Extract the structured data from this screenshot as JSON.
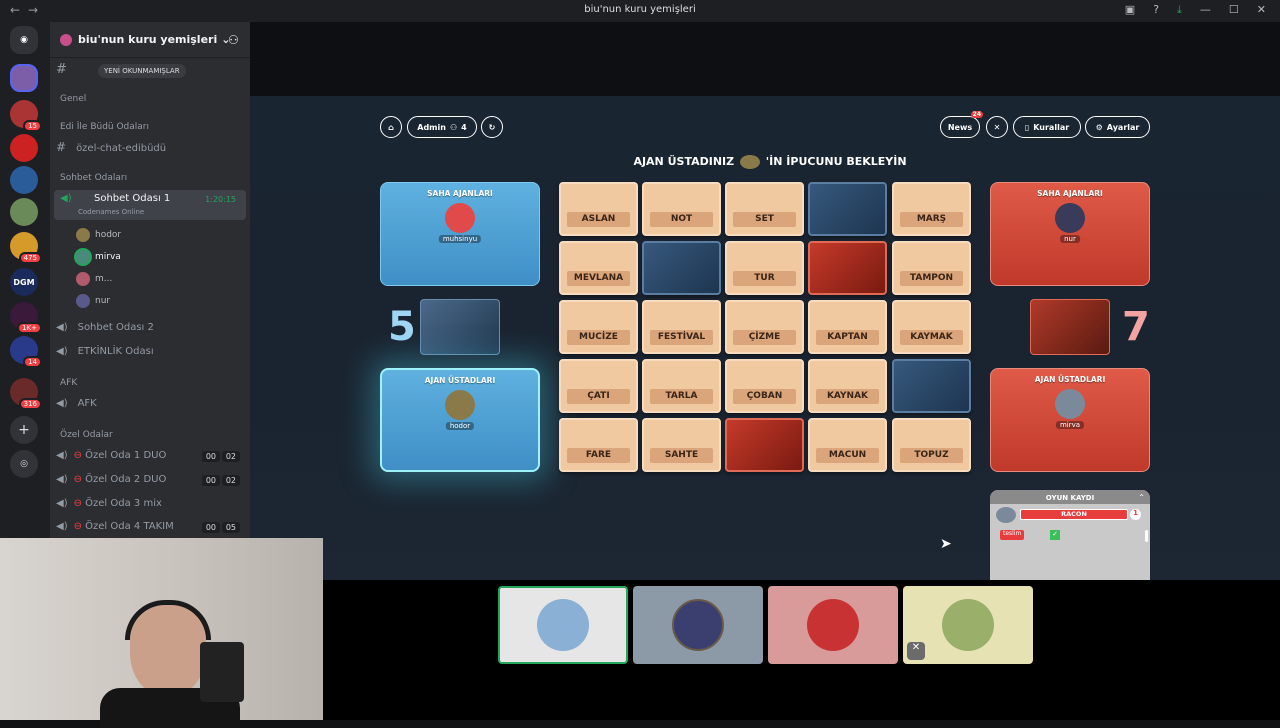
{
  "window": {
    "title": "biu'nun kuru yemişleri"
  },
  "sidebar": {
    "guild_name": "biu'nun kuru yemişleri",
    "unread_pill": "YENİ OKUNMAMIŞLAR",
    "server_badges": [
      "15",
      "475",
      "1K+",
      "14",
      "316"
    ],
    "server_label_dgm": "DGM",
    "categories": {
      "genel": "Genel",
      "edi_budu": "Edi İle Büdü Odaları",
      "sohbet": "Sohbet Odaları",
      "afk": "AFK",
      "ozel": "Özel Odalar"
    },
    "channels": {
      "ozel_chat": "özel-chat-edibüdü",
      "sohbet1": "Sohbet Odası 1",
      "sohbet1_activity": "Codenames Online",
      "sohbet1_time": "1:20:15",
      "sohbet2": "Sohbet Odası 2",
      "etkinlik": "ETKİNLİK Odası",
      "afk": "AFK",
      "oda1": "Özel Oda 1 DUO",
      "oda2": "Özel Oda 2 DUO",
      "oda3": "Özel Oda 3 mix",
      "oda4": "Özel Oda 4 TAKIM"
    },
    "voice_users": [
      "hodor",
      "mirva",
      "m...",
      "nur"
    ],
    "room_counts": {
      "oda1": [
        "00",
        "02"
      ],
      "oda2": [
        "00",
        "02"
      ],
      "oda4": [
        "00",
        "05"
      ]
    }
  },
  "game": {
    "buttons": {
      "admin": "Admin",
      "players": "4",
      "news": "News",
      "news_badge": "24",
      "rules": "Kurallar",
      "settings": "Ayarlar"
    },
    "banner_pre": "AJAN ÜSTADINIZ",
    "banner_post": "'İN İPUCUNU BEKLEYİN",
    "blue": {
      "operatives_label": "SAHA AJANLARI",
      "operative": "muhsinyu",
      "spymaster_label": "AJAN ÜSTADLARI",
      "spymaster": "hodor",
      "score": "5"
    },
    "red": {
      "operatives_label": "SAHA AJANLARI",
      "operative": "nur",
      "spymaster_label": "AJAN ÜSTADLARI",
      "spymaster": "mirva",
      "score": "7"
    },
    "cards": [
      [
        "ASLAN",
        "NOT",
        "SET",
        "",
        "MARŞ"
      ],
      [
        "MEVLANA",
        "",
        "TUR",
        "",
        "TAMPON"
      ],
      [
        "MUCİZE",
        "FESTİVAL",
        "ÇİZME",
        "KAPTAN",
        "KAYMAK"
      ],
      [
        "ÇATI",
        "TARLA",
        "ÇOBAN",
        "KAYNAK",
        ""
      ],
      [
        "FARE",
        "SAHTE",
        "",
        "MACUN",
        "TOPUZ"
      ]
    ],
    "card_colors": [
      [
        "n",
        "n",
        "n",
        "b",
        "n"
      ],
      [
        "n",
        "b",
        "n",
        "r",
        "n"
      ],
      [
        "n",
        "n",
        "n",
        "n",
        "n"
      ],
      [
        "n",
        "n",
        "n",
        "n",
        "b"
      ],
      [
        "n",
        "n",
        "r",
        "n",
        "n"
      ]
    ],
    "log": {
      "title": "OYUN KAYDI",
      "clue": "RACON",
      "clue_count": "1",
      "entry": "teslim",
      "user": "mirva"
    }
  },
  "colors": {
    "blue_team": "#3f8fc6",
    "red_team": "#c0392b",
    "card": "#f0c9a0",
    "online": "#23a55a"
  }
}
